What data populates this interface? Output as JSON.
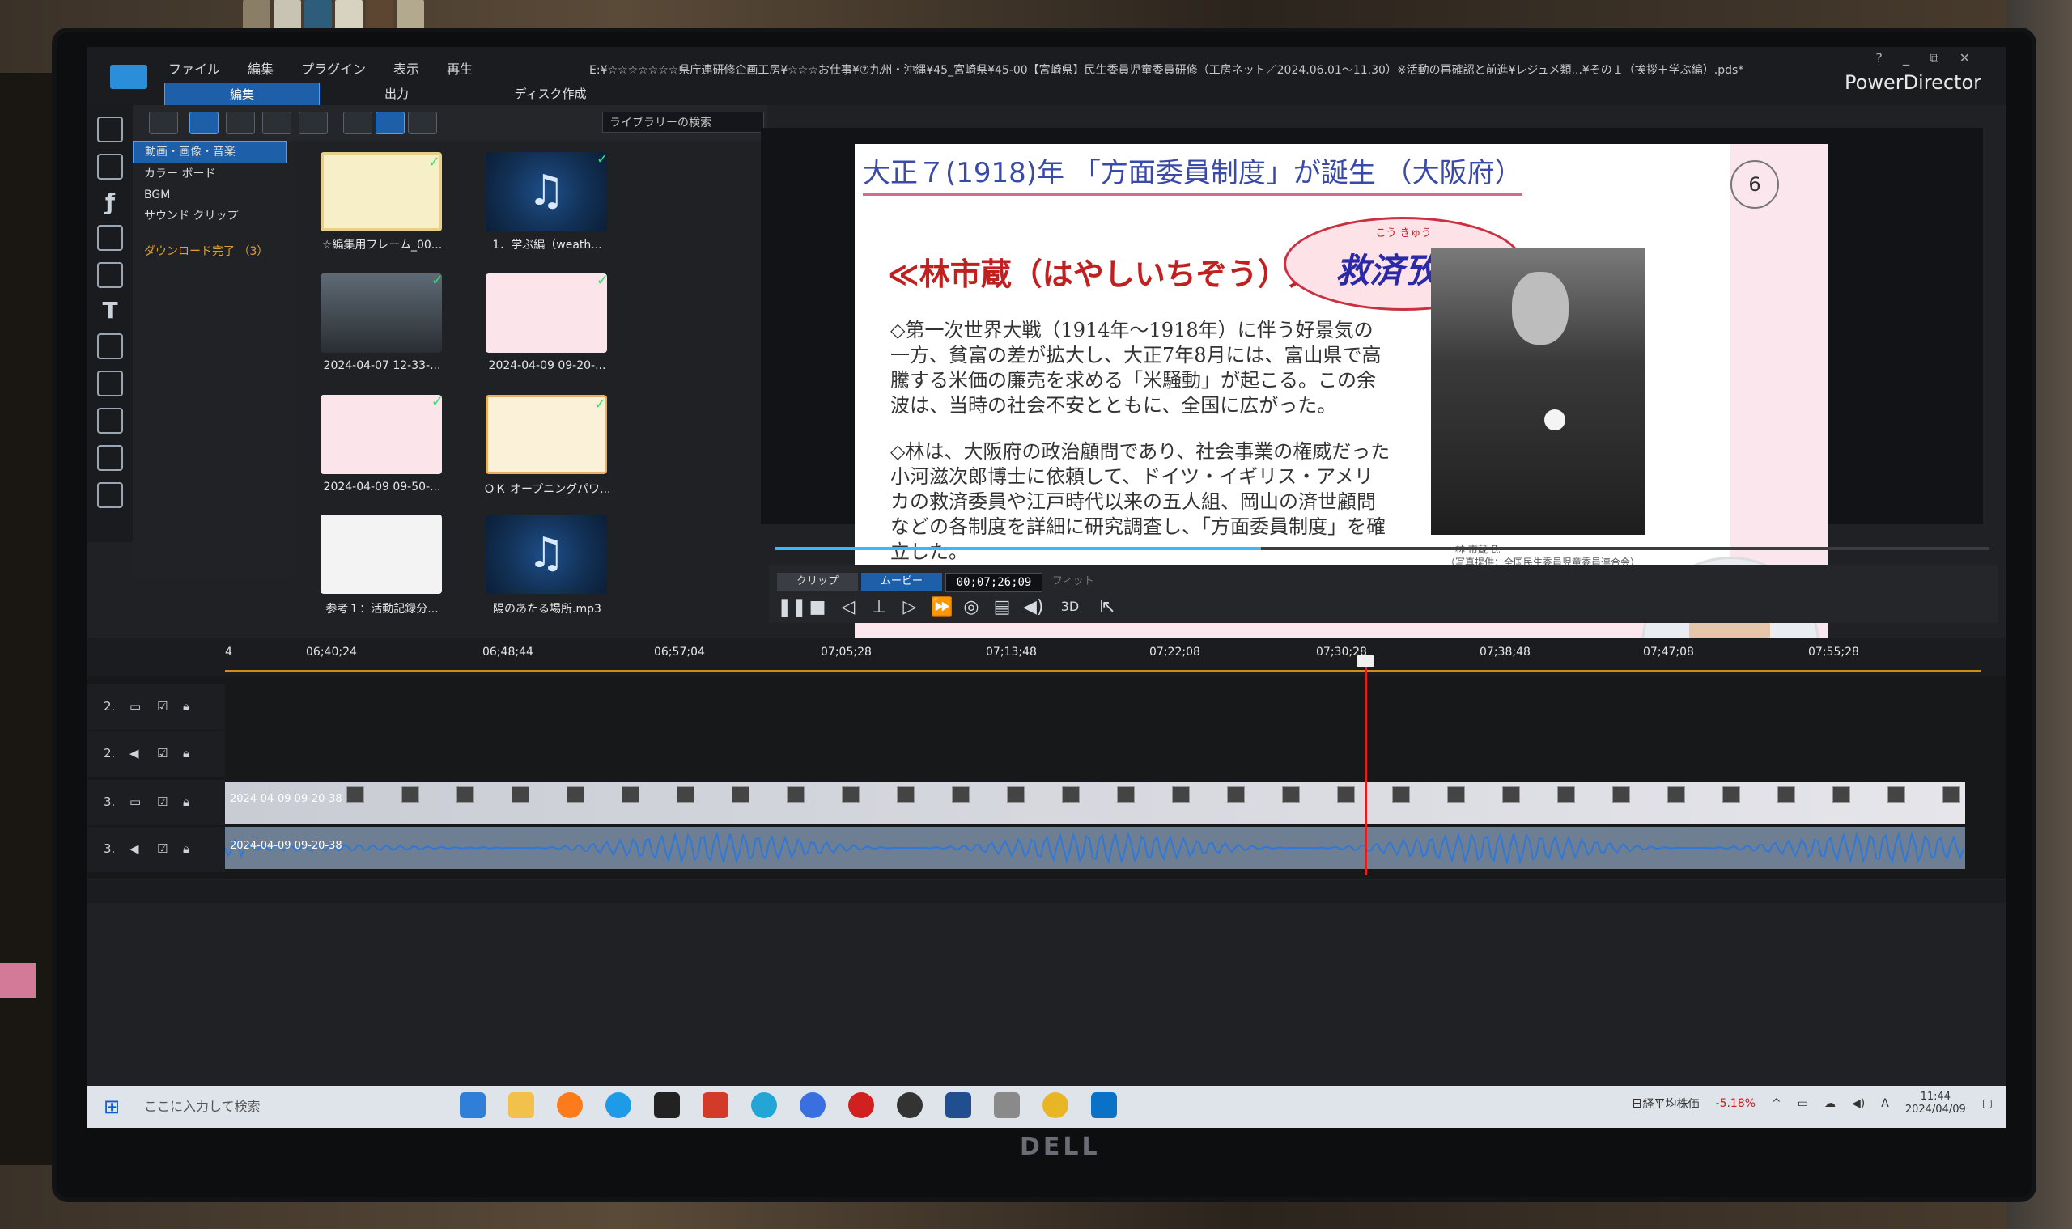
{
  "app": {
    "name": "PowerDirector",
    "file_path": "E:¥☆☆☆☆☆☆☆県庁連研修企画工房¥☆☆☆お仕事¥⑦九州・沖縄¥45_宮崎県¥45-00【宮崎県】民生委員児童委員研修（工房ネット／2024.06.01〜11.30）※活動の再確認と前進¥レジュメ類...¥その１（挨拶＋学ぶ編）.pds*",
    "window_controls": "? _ ⧉ ✕"
  },
  "menu": [
    "ファイル",
    "編集",
    "プラグイン",
    "表示",
    "再生"
  ],
  "mode_tabs": [
    "編集",
    "出力",
    "ディスク作成"
  ],
  "library": {
    "search_placeholder": "ライブラリーの検索",
    "categories": [
      "動画・画像・音楽",
      "カラー ボード",
      "BGM",
      "サウンド クリップ"
    ],
    "download_label": "ダウンロード完了 （3）",
    "items": [
      {
        "label": "☆編集用フレーム_00...",
        "kind": "image"
      },
      {
        "label": "1．学ぶ編（weath...",
        "kind": "music"
      },
      {
        "label": "2024-04-07 12-33-...",
        "kind": "video"
      },
      {
        "label": "2024-04-09 09-20-...",
        "kind": "slide"
      },
      {
        "label": "2024-04-09 09-50-...",
        "kind": "slide"
      },
      {
        "label": "ＯＫ オープニングパワ...",
        "kind": "slide"
      },
      {
        "label": "参考１：活動記録分...",
        "kind": "document"
      },
      {
        "label": "陽のあたる場所.mp3",
        "kind": "music"
      }
    ]
  },
  "slide": {
    "title": "大正７(1918)年 「方面委員制度」が誕生 （大阪府）",
    "page_number": "6",
    "subhead": "≪林市蔵（はやしいちぞう）大阪府知事≫",
    "oval_ruby": "こう きゅう",
    "oval_text": "救済攷究",
    "bullet1": "◇第一次世界大戦（1914年〜1918年）に伴う好景気の一方、貧富の差が拡大し、大正7年8月には、富山県で高騰する米価の廉売を求める「米騒動」が起こる。この余波は、当時の社会不安とともに、全国に広がった。",
    "bullet2": "◇林は、大阪府の政治顧問であり、社会事業の権威だった小河滋次郎博士に依頼して、ドイツ・イギリス・アメリカの救済委員や江戸時代以来の五人組、岡山の済世顧問などの各制度を詳細に研究調査し、「方面委員制度」を確立した。",
    "caption_name": "林 市蔵 氏",
    "caption_source": "（写真提供：全国民生委員児童委員連合会）"
  },
  "transport": {
    "clip_tab": "クリップ",
    "movie_tab": "ムービー",
    "timecode": "00;07;26;09",
    "fit": "フィット",
    "three_d": "3D"
  },
  "timeline": {
    "ruler": [
      "4",
      "06;40;24",
      "06;48;44",
      "06;57;04",
      "07;05;28",
      "07;13;48",
      "07;22;08",
      "07;30;28",
      "07;38;48",
      "07;47;08",
      "07;55;28"
    ],
    "tracks": [
      "2.",
      "2.",
      "3.",
      "3."
    ],
    "video_clip_label": "2024-04-09 09-20-38",
    "audio_clip_label": "2024-04-09 09-20-38"
  },
  "taskbar": {
    "search_placeholder": "ここに入力して検索",
    "stock_label": "日経平均株価",
    "stock_change": "-5.18%",
    "ime": "A",
    "time": "11:44",
    "date": "2024/04/09"
  },
  "bezel_brand": "DELL"
}
